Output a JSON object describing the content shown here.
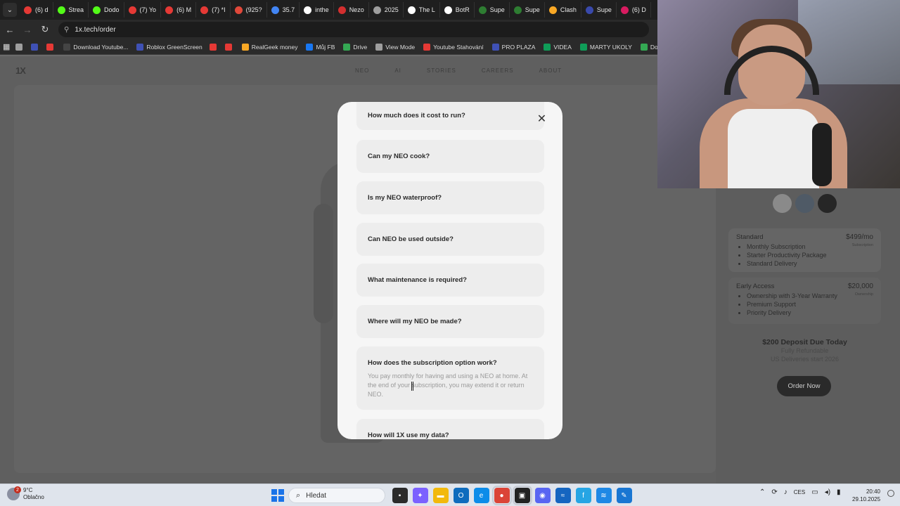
{
  "browser": {
    "tabs": [
      {
        "label": "(6) d",
        "color": "#e53935"
      },
      {
        "label": "Strea",
        "color": "#53fc18"
      },
      {
        "label": "Dodo",
        "color": "#53fc18"
      },
      {
        "label": "(7) Yo",
        "color": "#e53935"
      },
      {
        "label": "(6) M",
        "color": "#e53935"
      },
      {
        "label": "(7) *I",
        "color": "#e53935"
      },
      {
        "label": "(925?",
        "color": "#e0483a"
      },
      {
        "label": "35.7",
        "color": "#4285f4"
      },
      {
        "label": "inthe",
        "color": "#ffffff"
      },
      {
        "label": "Nezo",
        "color": "#d32f2f"
      },
      {
        "label": "2025",
        "color": "#9e9e9e"
      },
      {
        "label": "The L",
        "color": "#ffffff"
      },
      {
        "label": "BotR",
        "color": "#ffffff"
      },
      {
        "label": "Supe",
        "color": "#2e7d32"
      },
      {
        "label": "Supe",
        "color": "#2e7d32"
      },
      {
        "label": "Clash",
        "color": "#f9a825"
      },
      {
        "label": "Supe",
        "color": "#3949ab"
      },
      {
        "label": "(6) D",
        "color": "#d81b60"
      }
    ],
    "tab_menu_icon": "chevron-down-icon",
    "url": "1x.tech/order",
    "bookmarks": [
      {
        "label": "",
        "color": "#9e9e9e"
      },
      {
        "label": "",
        "color": "#3f51b5"
      },
      {
        "label": "",
        "color": "#e53935"
      },
      {
        "label": "Download Youtube...",
        "color": "#444444"
      },
      {
        "label": "Roblox GreenScreen",
        "color": "#3f51b5"
      },
      {
        "label": "",
        "color": "#e53935"
      },
      {
        "label": "",
        "color": "#e53935"
      },
      {
        "label": "RealGeek money",
        "color": "#f9a825"
      },
      {
        "label": "Můj FB",
        "color": "#1877f2"
      },
      {
        "label": "Drive",
        "color": "#34a853"
      },
      {
        "label": "View Mode",
        "color": "#9e9e9e"
      },
      {
        "label": "Youtube Stahování",
        "color": "#e53935"
      },
      {
        "label": "PRO PLAZA",
        "color": "#3f51b5"
      },
      {
        "label": "VIDEA",
        "color": "#0f9d58"
      },
      {
        "label": "MARTY UKOLY",
        "color": "#0f9d58"
      },
      {
        "label": "Dodo videa",
        "color": "#34a853"
      }
    ]
  },
  "site": {
    "logo": "1X",
    "nav": [
      "NEO",
      "AI",
      "STORIES",
      "CAREERS",
      "ABOUT"
    ]
  },
  "modal": {
    "faqs": [
      {
        "q": "How much does it cost to run?"
      },
      {
        "q": "Can my NEO cook?"
      },
      {
        "q": "Is my NEO waterproof?"
      },
      {
        "q": "Can NEO be used outside?"
      },
      {
        "q": "What maintenance is required?"
      },
      {
        "q": "Where will my NEO be made?"
      },
      {
        "q": "How does the subscription option work?",
        "a": "You pay monthly for having and using a NEO at home. At the end of your subscription, you may extend it or return NEO."
      },
      {
        "q": "How will 1X use my data?"
      }
    ],
    "close_icon": "close-icon"
  },
  "order": {
    "swatch_colors": [
      "#8a8a8a",
      "#4f5a66",
      "#262626"
    ],
    "standard": {
      "title": "Standard",
      "price": "$499/mo",
      "note": "Subscription",
      "features": [
        "Monthly Subscription",
        "Starter Productivity Package",
        "Standard Delivery"
      ]
    },
    "early": {
      "title": "Early Access",
      "price": "$20,000",
      "note": "Ownership",
      "features": [
        "Ownership with 3-Year Warranty",
        "Premium Support",
        "Priority Delivery"
      ]
    },
    "deposit_title": "$200 Deposit Due Today",
    "deposit_sub1": "Fully Refundable",
    "deposit_sub2": "US Deliveries start 2026",
    "order_button": "Order Now"
  },
  "taskbar": {
    "weather_temp": "9°C",
    "weather_desc": "Oblačno",
    "weather_badge": "2",
    "search_placeholder": "Hledat",
    "lang": "CES",
    "time": "20:40",
    "date": "29.10.2025"
  }
}
